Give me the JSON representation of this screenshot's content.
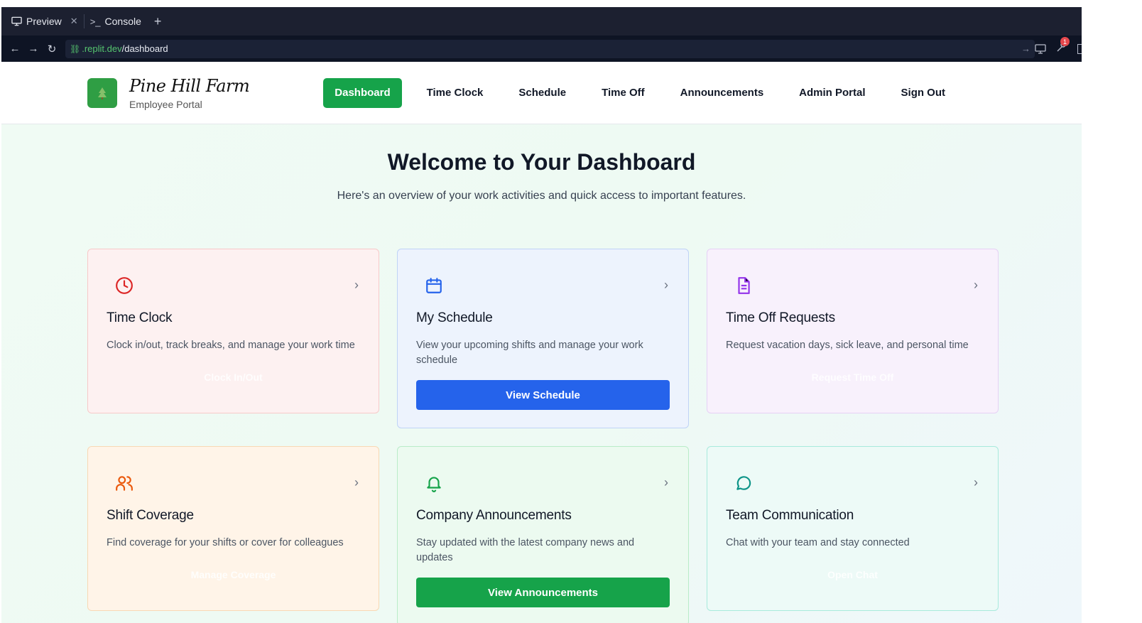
{
  "browser": {
    "tabs": [
      {
        "label": "Preview",
        "icon": "monitor-icon",
        "active": true
      },
      {
        "label": "Console",
        "icon": "terminal-icon",
        "active": false
      }
    ],
    "url_domain": ".replit.dev",
    "url_path": "/dashboard",
    "notification_count": "1"
  },
  "header": {
    "brand_name": "Pine Hill Farm",
    "brand_sub": "Employee Portal",
    "nav": [
      {
        "label": "Dashboard",
        "active": true
      },
      {
        "label": "Time Clock",
        "active": false
      },
      {
        "label": "Schedule",
        "active": false
      },
      {
        "label": "Time Off",
        "active": false
      },
      {
        "label": "Announcements",
        "active": false
      },
      {
        "label": "Admin Portal",
        "active": false
      },
      {
        "label": "Sign Out",
        "active": false
      }
    ]
  },
  "main": {
    "title": "Welcome to Your Dashboard",
    "lead": "Here's an overview of your work activities and quick access to important features.",
    "cards": [
      {
        "title": "Time Clock",
        "desc": "Clock in/out, track breaks, and manage your work time",
        "action": "Clock In/Out",
        "icon": "clock-icon",
        "accent": "#dc2626"
      },
      {
        "title": "My Schedule",
        "desc": "View your upcoming shifts and manage your work schedule",
        "action": "View Schedule",
        "icon": "calendar-icon",
        "accent": "#2563eb"
      },
      {
        "title": "Time Off Requests",
        "desc": "Request vacation days, sick leave, and personal time",
        "action": "Request Time Off",
        "icon": "document-icon",
        "accent": "#9333ea"
      },
      {
        "title": "Shift Coverage",
        "desc": "Find coverage for your shifts or cover for colleagues",
        "action": "Manage Coverage",
        "icon": "users-icon",
        "accent": "#ea580c"
      },
      {
        "title": "Company Announcements",
        "desc": "Stay updated with the latest company news and updates",
        "action": "View Announcements",
        "icon": "bell-icon",
        "accent": "#16a34a"
      },
      {
        "title": "Team Communication",
        "desc": "Chat with your team and stay connected",
        "action": "Open Chat",
        "icon": "chat-icon",
        "accent": "#0d9488"
      }
    ]
  }
}
